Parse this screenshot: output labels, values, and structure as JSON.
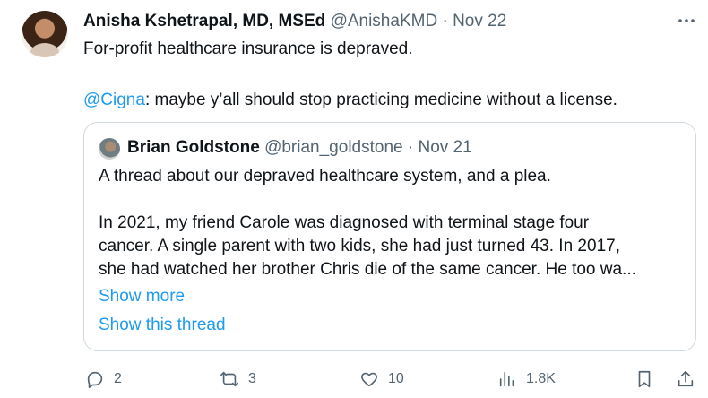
{
  "tweet": {
    "author_name": "Anisha Kshetrapal, MD, MSEd",
    "handle": "@AnishaKMD",
    "separator": " · ",
    "date": "Nov 22",
    "line1": "For-profit healthcare insurance is depraved.",
    "mention": "@Cigna",
    "line2_rest": ": maybe y’all should stop practicing medicine without a license."
  },
  "quoted": {
    "author_name": "Brian Goldstone",
    "handle": "@brian_goldstone",
    "separator": " · ",
    "date": "Nov 21",
    "para1": "A thread about our depraved healthcare system, and a plea.",
    "para2_line1": "In 2021, my friend Carole was diagnosed with terminal stage four",
    "para2_line2": "cancer. A single parent with two kids, she had just turned 43. In 2017,",
    "para2_line3": "she had watched her brother Chris die of the same cancer. He too wa...",
    "show_more": "Show more",
    "show_thread": "Show this thread"
  },
  "actions": {
    "replies": "2",
    "retweets": "3",
    "likes": "10",
    "views": "1.8K"
  },
  "icons": [
    "more-icon",
    "reply-icon",
    "retweet-icon",
    "like-icon",
    "views-icon",
    "bookmark-icon",
    "share-icon"
  ],
  "colors": {
    "link": "#1d9bf0",
    "muted": "#536471",
    "text": "#0f1419",
    "border": "#cfd9de"
  }
}
